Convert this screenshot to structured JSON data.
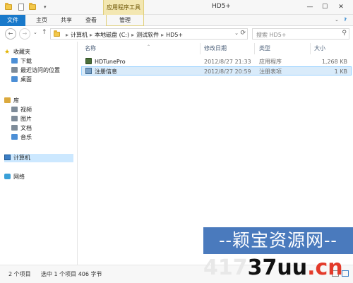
{
  "window": {
    "title": "HD5+",
    "context_tab": "应用程序工具",
    "controls": {
      "minimize": "—",
      "maximize": "☐",
      "close": "✕"
    }
  },
  "ribbon": {
    "tabs": [
      "文件",
      "主页",
      "共享",
      "查看",
      "管理"
    ],
    "expand_glyph": "⌄",
    "help_glyph": "?"
  },
  "navigation": {
    "back_glyph": "←",
    "forward_glyph": "→",
    "recent_glyph": "⌄",
    "up_glyph": "↑",
    "breadcrumb": [
      "计算机",
      "本地磁盘 (C:)",
      "测试软件",
      "HD5+"
    ],
    "crumb_separator": "▸",
    "dropdown_glyph": "⌄",
    "refresh_glyph": "⟳",
    "search_placeholder": "搜索 HD5+",
    "search_icon_glyph": "⚲"
  },
  "sidebar": {
    "favorites": {
      "label": "收藏夹",
      "items": [
        "下载",
        "最近访问的位置",
        "桌面"
      ]
    },
    "libraries": {
      "label": "库",
      "items": [
        "视频",
        "图片",
        "文档",
        "音乐"
      ]
    },
    "computer": "计算机",
    "network": "网络"
  },
  "columns": {
    "name": "名称",
    "date": "修改日期",
    "type": "类型",
    "size": "大小"
  },
  "files": [
    {
      "name": "HDTunePro",
      "date": "2012/8/27 21:33",
      "type": "应用程序",
      "size": "1,268 KB"
    },
    {
      "name": "注册信息",
      "date": "2012/8/27 20:59",
      "type": "注册表项",
      "size": "1 KB"
    }
  ],
  "status": {
    "items_count": "2 个项目",
    "selection": "选中 1 个项目 406 字节"
  },
  "watermark": {
    "line1": "--颖宝资源网--",
    "line2_prefix": "417",
    "line2_main": "37uu",
    "line2_suffix": ".cn"
  }
}
